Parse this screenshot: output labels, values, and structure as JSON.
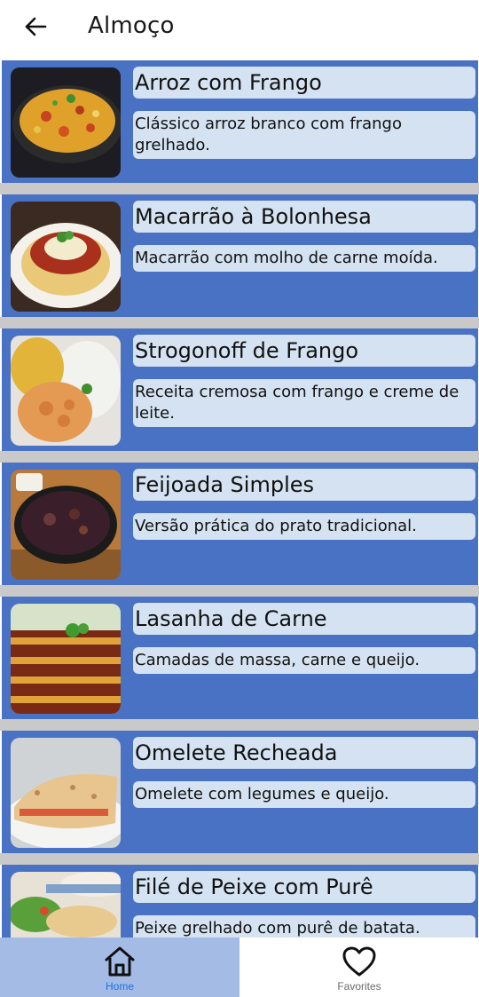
{
  "appbar": {
    "title": "Almoço",
    "back_icon": "arrow-back-icon"
  },
  "recipes": [
    {
      "title": "Arroz com Frango",
      "description": "Clássico arroz branco com frango grelhado.",
      "image": "arroz-com-frango-photo"
    },
    {
      "title": "Macarrão à Bolonhesa",
      "description": "Macarrão com molho de carne moída.",
      "image": "macarrao-bolonhesa-photo"
    },
    {
      "title": "Strogonoff de Frango",
      "description": "Receita cremosa com frango e creme de leite.",
      "image": "strogonoff-photo"
    },
    {
      "title": "Feijoada Simples",
      "description": "Versão prática do prato tradicional.",
      "image": "feijoada-photo"
    },
    {
      "title": "Lasanha de Carne",
      "description": "Camadas de massa, carne e queijo.",
      "image": "lasanha-photo"
    },
    {
      "title": "Omelete Recheada",
      "description": "Omelete com legumes e queijo.",
      "image": "omelete-photo"
    },
    {
      "title": "Filé de Peixe com Purê",
      "description": "Peixe grelhado com purê de batata.",
      "image": "peixe-pure-photo"
    }
  ],
  "bottom_nav": {
    "items": [
      {
        "label": "Home",
        "icon": "home-icon",
        "active": true
      },
      {
        "label": "Favorites",
        "icon": "heart-icon",
        "active": false
      }
    ]
  },
  "colors": {
    "card_bg": "#4a72c4",
    "text_box_bg": "#d4e2f2",
    "separator": "#c9c9c9",
    "nav_active_bg": "#a4bbe6",
    "nav_active_text": "#1e6fe0"
  }
}
